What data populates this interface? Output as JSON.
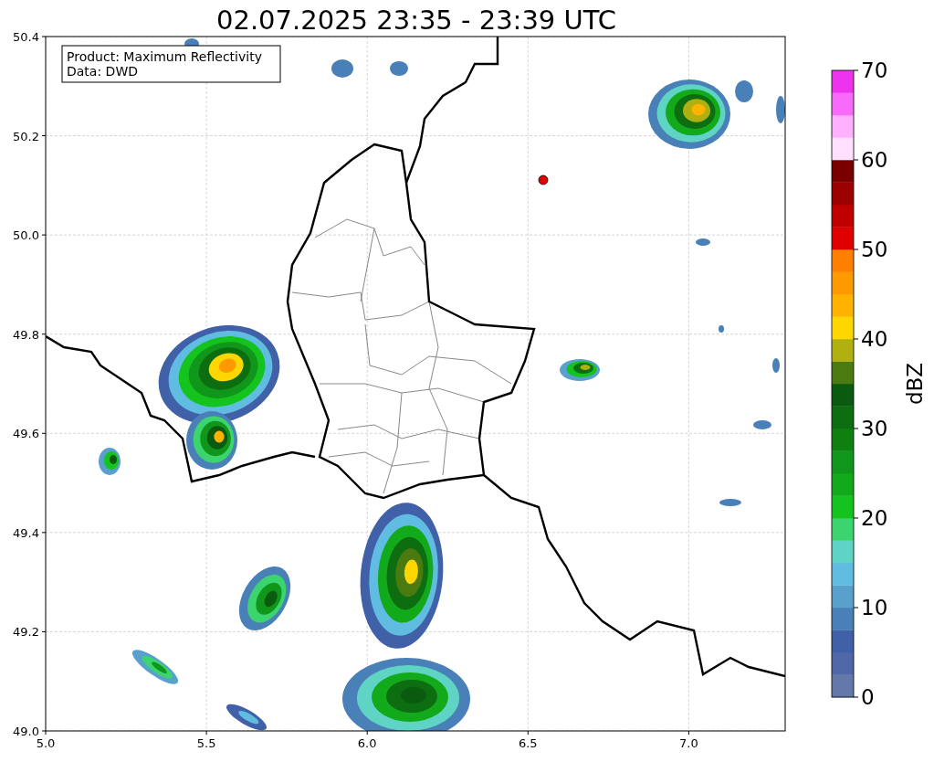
{
  "title": "02.07.2025 23:35 - 23:39 UTC",
  "info_box": {
    "lines": [
      "Product: Maximum Reflectivity",
      "Data: DWD"
    ]
  },
  "map": {
    "x_ticks": [
      "5.0",
      "5.5",
      "6.0",
      "6.5",
      "7.0"
    ],
    "y_ticks": [
      "50.4",
      "50.2",
      "50.0",
      "49.8",
      "49.6",
      "49.4",
      "49.2",
      "49.0"
    ]
  },
  "colorbar": {
    "label": "dBZ",
    "ticks": [
      "70",
      "60",
      "50",
      "40",
      "30",
      "20",
      "10",
      "0"
    ],
    "steps": [
      {
        "color": "#6478aa"
      },
      {
        "color": "#5068a8"
      },
      {
        "color": "#4060a8"
      },
      {
        "color": "#4a80b8"
      },
      {
        "color": "#5aa0cc"
      },
      {
        "color": "#60bce0"
      },
      {
        "color": "#60d4c4"
      },
      {
        "color": "#3cd46e"
      },
      {
        "color": "#14c31e"
      },
      {
        "color": "#12aa1a"
      },
      {
        "color": "#10961a"
      },
      {
        "color": "#0e8010"
      },
      {
        "color": "#0c6e10"
      },
      {
        "color": "#0a5a10"
      },
      {
        "color": "#4a7a10"
      },
      {
        "color": "#b0b010"
      },
      {
        "color": "#ffd700"
      },
      {
        "color": "#ffb300"
      },
      {
        "color": "#ff9900"
      },
      {
        "color": "#ff7f00"
      },
      {
        "color": "#e00000"
      },
      {
        "color": "#c00000"
      },
      {
        "color": "#9c0000"
      },
      {
        "color": "#7a0000"
      },
      {
        "color": "#ffe0ff"
      },
      {
        "color": "#ffb0ff"
      },
      {
        "color": "#f86bf8"
      },
      {
        "color": "#ee33ee"
      }
    ]
  }
}
